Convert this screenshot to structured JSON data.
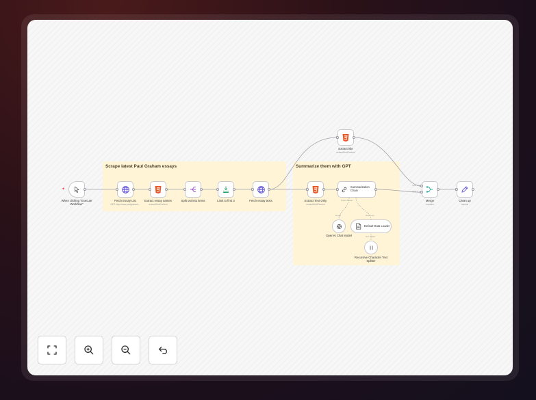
{
  "colors": {
    "accent_red": "#ff4d5a",
    "accent_orange": "#ea5b2a",
    "accent_purple": "#6b5cdb",
    "accent_green": "#2ea36b",
    "accent_teal": "#23a8a3",
    "sticky_bg": "#fff5d6"
  },
  "stickies": {
    "scrape": {
      "title": "Scrape latest Paul Graham essays"
    },
    "summarize": {
      "title": "Summarize them with GPT"
    }
  },
  "nodes": {
    "trigger": {
      "title": "When clicking \"Execute Workflow\"",
      "icon": "cursor-click-icon"
    },
    "fetch_list": {
      "title": "Fetch Essay List",
      "subtitle": "GET: http://www.paulgraham...",
      "icon": "globe-icon"
    },
    "extract_names": {
      "title": "Extract essay names",
      "subtitle": "extractHtmlContent",
      "icon": "html5-icon"
    },
    "split_out": {
      "title": "Split out into items",
      "icon": "split-icon"
    },
    "limit": {
      "title": "Limit to first 3",
      "icon": "limit-icon"
    },
    "fetch_texts": {
      "title": "Fetch essay texts",
      "icon": "globe-icon"
    },
    "extract_title": {
      "title": "Extract title",
      "subtitle": "extractHtmlContent",
      "icon": "html5-icon"
    },
    "extract_text": {
      "title": "Extract Text Only",
      "subtitle": "extractHtmlContent",
      "icon": "html5-icon"
    },
    "summarization": {
      "title": "Summarization Chain",
      "icon": "link-chain-icon"
    },
    "merge": {
      "title": "Merge",
      "subtitle": "combine",
      "icon": "merge-icon"
    },
    "clean_up": {
      "title": "Clean up",
      "subtitle": "manual",
      "icon": "pencil-icon"
    },
    "openai": {
      "title": "OpenAI Chat Model",
      "icon": "openai-icon"
    },
    "loader": {
      "title": "Default Data Loader",
      "icon": "document-icon"
    },
    "splitter": {
      "title": "Recursive Character Text Splitter",
      "icon": "text-splitter-icon"
    }
  },
  "ports": {
    "model": "Model",
    "document": "Document",
    "text_splitter": "Text Splitter",
    "sum_output": "Output Parser",
    "input1": "Input 1",
    "input2": "Input 2"
  },
  "controls": [
    {
      "name": "fit-view",
      "icon": "fullscreen-icon"
    },
    {
      "name": "zoom-in",
      "icon": "zoom-in-icon"
    },
    {
      "name": "zoom-out",
      "icon": "zoom-out-icon"
    },
    {
      "name": "reset-zoom",
      "icon": "undo-icon"
    }
  ]
}
